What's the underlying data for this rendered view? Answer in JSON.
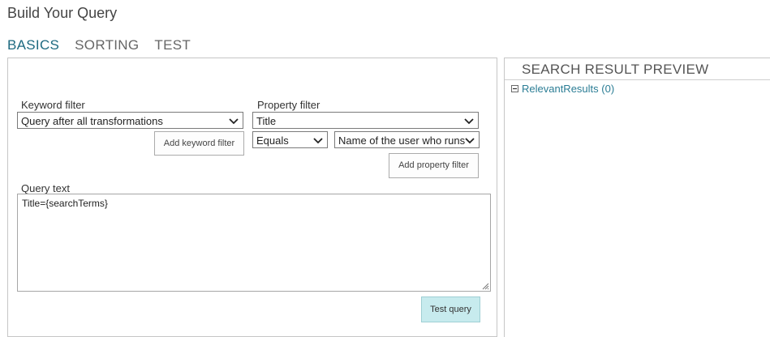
{
  "page": {
    "title": "Build Your Query"
  },
  "tabs": [
    {
      "label": "BASICS",
      "active": true
    },
    {
      "label": "SORTING",
      "active": false
    },
    {
      "label": "TEST",
      "active": false
    }
  ],
  "keyword_filter": {
    "label": "Keyword filter",
    "selected": "Query after all transformations",
    "add_button": "Add keyword filter"
  },
  "property_filter": {
    "label": "Property filter",
    "property_selected": "Title",
    "operator_selected": "Equals",
    "value_selected": "Name of the user who runs",
    "add_button": "Add property filter"
  },
  "query_text": {
    "label": "Query text",
    "value": "Title={searchTerms}"
  },
  "test_button": "Test query",
  "preview": {
    "title": "SEARCH RESULT PREVIEW",
    "tree": [
      {
        "label": "RelevantResults (0)",
        "expanded": true
      }
    ]
  },
  "colors": {
    "accent": "#1e6a80",
    "link": "#2b7d95",
    "primary_button": "#c7ebee"
  },
  "icons": {
    "dropdown": "chevron-down-icon",
    "tree_toggle": "collapse-minus-icon",
    "resize": "resize-grip-icon"
  }
}
